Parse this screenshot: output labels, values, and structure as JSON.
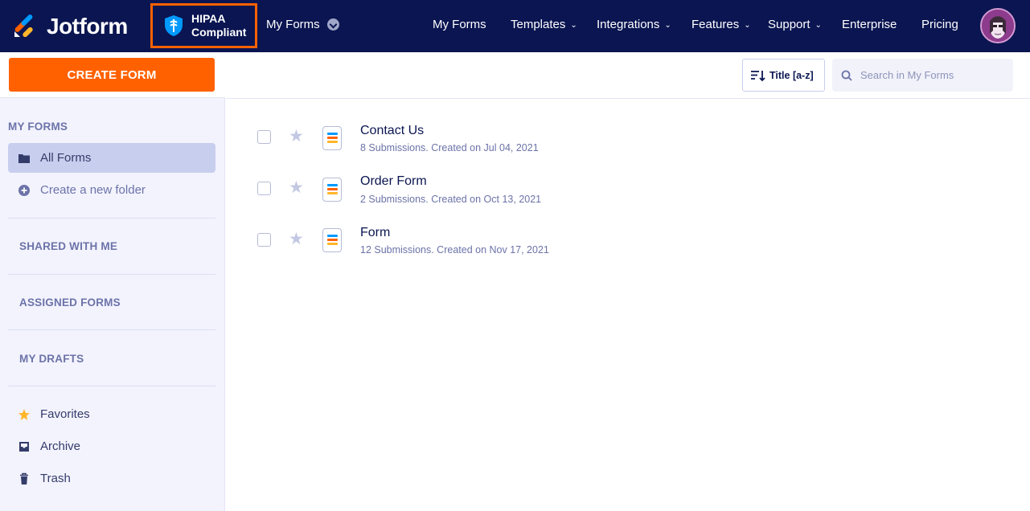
{
  "brand": {
    "name": "Jotform",
    "colors": {
      "navy": "#0a1551",
      "orange": "#ff6100",
      "sidebar_bg": "#f3f3fe",
      "active": "#c8ceed"
    }
  },
  "hipaa": {
    "line1": "HIPAA",
    "line2": "Compliant",
    "icon": "shield-icon"
  },
  "header": {
    "context_dropdown": "My Forms",
    "nav": [
      {
        "label": "My Forms",
        "has_dropdown": false
      },
      {
        "label": "Templates",
        "has_dropdown": true
      },
      {
        "label": "Integrations",
        "has_dropdown": true
      },
      {
        "label": "Features",
        "has_dropdown": true
      },
      {
        "label": "Support",
        "has_dropdown": true
      },
      {
        "label": "Enterprise",
        "has_dropdown": false
      },
      {
        "label": "Pricing",
        "has_dropdown": false
      }
    ]
  },
  "sidebar": {
    "create_label": "CREATE FORM",
    "my_forms_title": "MY FORMS",
    "all_forms": "All Forms",
    "new_folder": "Create a new folder",
    "shared": "SHARED WITH ME",
    "assigned": "ASSIGNED FORMS",
    "drafts": "MY DRAFTS",
    "favorites": "Favorites",
    "archive": "Archive",
    "trash": "Trash"
  },
  "toolbar": {
    "sort_label": "Title [a-z]",
    "search_placeholder": "Search in My Forms"
  },
  "forms": [
    {
      "title": "Contact Us",
      "meta": "8 Submissions. Created on Jul 04, 2021"
    },
    {
      "title": "Order Form",
      "meta": "2 Submissions. Created on Oct 13, 2021"
    },
    {
      "title": "Form",
      "meta": "12 Submissions. Created on Nov 17, 2021"
    }
  ]
}
